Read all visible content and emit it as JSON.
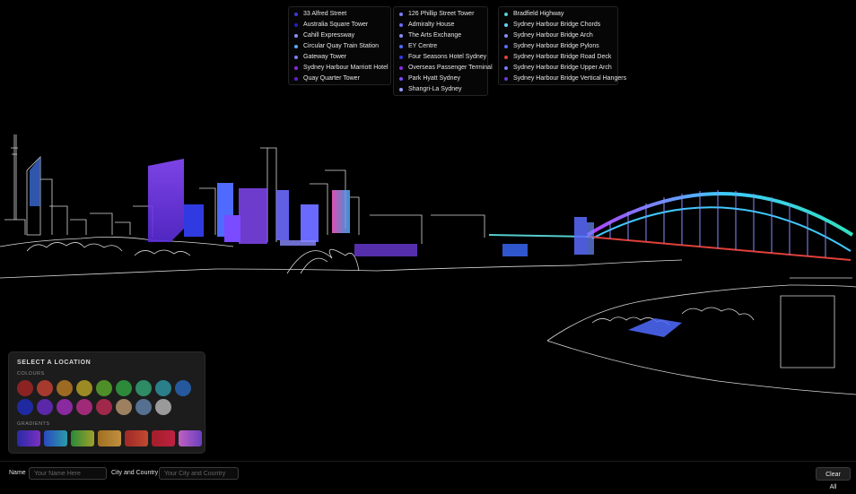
{
  "legend": {
    "columns": [
      [
        {
          "label": "33 Alfred Street",
          "color": "#3b3bd6"
        },
        {
          "label": "Australia Square Tower",
          "color": "#2020c0"
        },
        {
          "label": "Cahill Expressway",
          "color": "#8c8cff"
        },
        {
          "label": "Circular Quay Train Station",
          "color": "#55aaff"
        },
        {
          "label": "Gateway Tower",
          "color": "#7c7cff"
        },
        {
          "label": "Sydney Harbour Marriott Hotel",
          "color": "#8a2be2"
        },
        {
          "label": "Quay Quarter Tower",
          "color": "#6a1bd6"
        }
      ],
      [
        {
          "label": "126 Phillip Street Tower",
          "color": "#7c7cff"
        },
        {
          "label": "Admiralty House",
          "color": "#6a6aff"
        },
        {
          "label": "The Arts Exchange",
          "color": "#8a8aff"
        },
        {
          "label": "EY Centre",
          "color": "#4f6bff"
        },
        {
          "label": "Four Seasons Hotel Sydney",
          "color": "#2f3be0"
        },
        {
          "label": "Overseas Passenger Terminal",
          "color": "#8a2be2"
        },
        {
          "label": "Park Hyatt Sydney",
          "color": "#7a4bff"
        },
        {
          "label": "Shangri-La Sydney",
          "color": "#9a9aff"
        }
      ],
      [
        {
          "label": "Bradfield Highway",
          "color": "#55cccc"
        },
        {
          "label": "Sydney Harbour Bridge Chords",
          "color": "#6bd0ff"
        },
        {
          "label": "Sydney Harbour Bridge Arch",
          "color": "#8a8aff"
        },
        {
          "label": "Sydney Harbour Bridge Pylons",
          "color": "#5b6bff"
        },
        {
          "label": "Sydney Harbour Bridge Road Deck",
          "color": "#e0403a"
        },
        {
          "label": "Sydney Harbour Bridge Upper Arch",
          "color": "#7a7aff"
        },
        {
          "label": "Sydney Harbour Bridge Vertical Hangers",
          "color": "#6a3bd6"
        }
      ]
    ]
  },
  "palette": {
    "title": "SELECT A LOCATION",
    "colours_label": "COLOURS",
    "gradients_label": "GRADIENTS",
    "colours_row1": [
      "#8b2323",
      "#a63a2e",
      "#9c6a22",
      "#9c8a24",
      "#4f8f2a",
      "#2c8a3a",
      "#2f8a66",
      "#2a7f8a",
      "#25589c"
    ],
    "colours_row2": [
      "#1f2aa0",
      "#5a28a8",
      "#8a2aa0",
      "#a02a78",
      "#a0284a",
      "#9c8060",
      "#557090",
      "#9a9a9a"
    ],
    "gradients": [
      [
        "#2a2aa8",
        "#7a30c0"
      ],
      [
        "#2a4ac0",
        "#2a9ca8"
      ],
      [
        "#2a8a3a",
        "#a0a02a"
      ],
      [
        "#a07020",
        "#c09040"
      ],
      [
        "#a02828",
        "#c04a30"
      ],
      [
        "#a0202a",
        "#c02040"
      ],
      [
        "#c060c0",
        "#6a40c0"
      ]
    ]
  },
  "bottombar": {
    "name_label": "Name",
    "name_placeholder": "Your Name Here",
    "city_label": "City and Country",
    "city_placeholder": "Your City and Country",
    "clear_label": "Clear All"
  }
}
